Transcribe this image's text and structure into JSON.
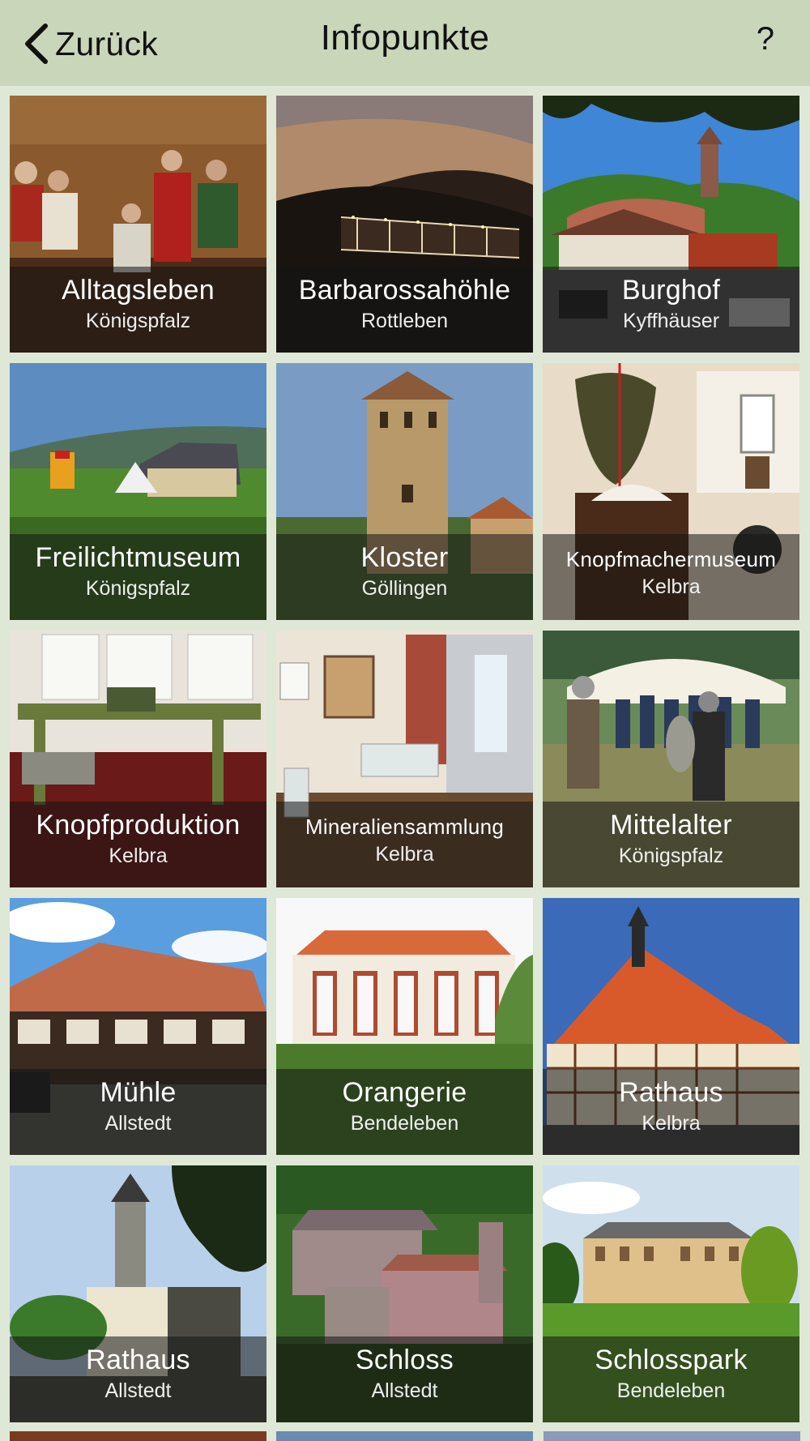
{
  "header": {
    "back_label": "Zurück",
    "title": "Infopunkte",
    "help_label": "?"
  },
  "tiles": [
    {
      "name": "Alltagsleben",
      "place": "Königspfalz"
    },
    {
      "name": "Barbarossahöhle",
      "place": "Rottleben"
    },
    {
      "name": "Burghof",
      "place": "Kyffhäuser"
    },
    {
      "name": "Freilichtmuseum",
      "place": "Königspfalz"
    },
    {
      "name": "Kloster",
      "place": "Göllingen"
    },
    {
      "name": "Knopfmachermuseum",
      "place": "Kelbra"
    },
    {
      "name": "Knopfproduktion",
      "place": "Kelbra"
    },
    {
      "name": "Mineraliensammlung",
      "place": "Kelbra"
    },
    {
      "name": "Mittelalter",
      "place": "Königspfalz"
    },
    {
      "name": "Mühle",
      "place": "Allstedt"
    },
    {
      "name": "Orangerie",
      "place": "Bendeleben"
    },
    {
      "name": "Rathaus",
      "place": "Kelbra"
    },
    {
      "name": "Rathaus",
      "place": "Allstedt"
    },
    {
      "name": "Schloss",
      "place": "Allstedt"
    },
    {
      "name": "Schlosspark",
      "place": "Bendeleben"
    }
  ]
}
